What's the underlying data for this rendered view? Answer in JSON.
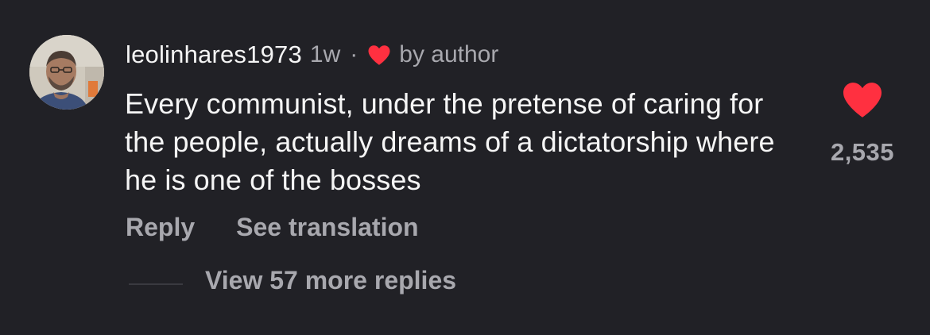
{
  "comment": {
    "username": "leolinhares1973",
    "time": "1w",
    "separator": "·",
    "by_author": "by author",
    "text": "Every communist, under the pretense of caring for the people, actually dreams of a dictatorship where he is one of the bosses",
    "like_count": "2,535",
    "liked": true,
    "heart_icon": "heart-icon",
    "heart_color": "#ff3040"
  },
  "actions": {
    "reply_label": "Reply",
    "translation_label": "See translation"
  },
  "replies": {
    "view_more_label": "View 57 more replies"
  },
  "colors": {
    "background": "#212126",
    "primary_text": "#f5f5f5",
    "secondary_text": "#a8a8ae",
    "accent_red": "#ff3040"
  }
}
